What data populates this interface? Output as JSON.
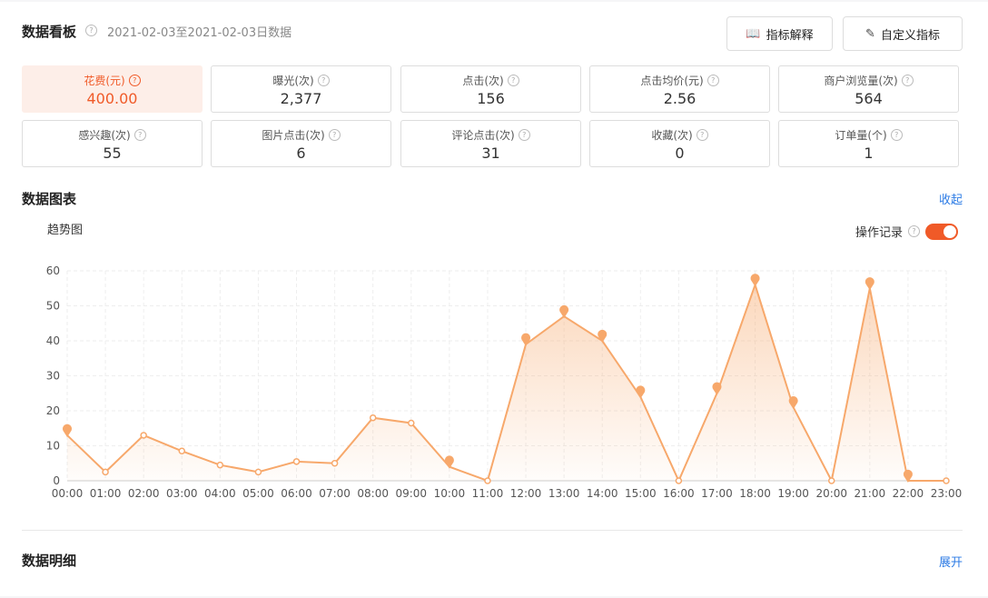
{
  "header": {
    "title": "数据看板",
    "date_range": "2021-02-03至2021-02-03日数据",
    "help_icon": "?",
    "explain_button": "指标解释",
    "custom_button": "自定义指标"
  },
  "metrics": [
    {
      "label": "花费(元)",
      "value": "400.00",
      "active": true
    },
    {
      "label": "曝光(次)",
      "value": "2,377"
    },
    {
      "label": "点击(次)",
      "value": "156"
    },
    {
      "label": "点击均价(元)",
      "value": "2.56"
    },
    {
      "label": "商户浏览量(次)",
      "value": "564"
    },
    {
      "label": "感兴趣(次)",
      "value": "55"
    },
    {
      "label": "图片点击(次)",
      "value": "6"
    },
    {
      "label": "评论点击(次)",
      "value": "31"
    },
    {
      "label": "收藏(次)",
      "value": "0"
    },
    {
      "label": "订单量(个)",
      "value": "1"
    }
  ],
  "chart_section": {
    "title": "数据图表",
    "collapse_label": "收起",
    "trend_label": "趋势图",
    "ops_label": "操作记录",
    "toggle_on": true
  },
  "detail_section": {
    "title": "数据明细",
    "expand_label": "展开"
  },
  "colors": {
    "accent": "#f05a28",
    "line": "#f7a86b",
    "link": "#2c7be5"
  },
  "chart_data": {
    "type": "area",
    "categories": [
      "00:00",
      "01:00",
      "02:00",
      "03:00",
      "04:00",
      "05:00",
      "06:00",
      "07:00",
      "08:00",
      "09:00",
      "10:00",
      "11:00",
      "12:00",
      "13:00",
      "14:00",
      "15:00",
      "16:00",
      "17:00",
      "18:00",
      "19:00",
      "20:00",
      "21:00",
      "22:00",
      "23:00"
    ],
    "values": [
      13,
      2.5,
      13,
      8.5,
      4.5,
      2.5,
      5.5,
      5,
      18,
      16.5,
      4,
      0,
      39,
      47,
      40,
      24,
      0,
      25,
      56,
      21,
      0,
      55,
      0,
      0
    ],
    "markers": [
      true,
      false,
      false,
      false,
      false,
      false,
      false,
      false,
      false,
      false,
      true,
      false,
      true,
      true,
      true,
      true,
      false,
      true,
      true,
      true,
      false,
      true,
      true,
      false
    ],
    "ylim": [
      0,
      60
    ],
    "yticks": [
      0,
      10,
      20,
      30,
      40,
      50,
      60
    ],
    "grid": true
  }
}
